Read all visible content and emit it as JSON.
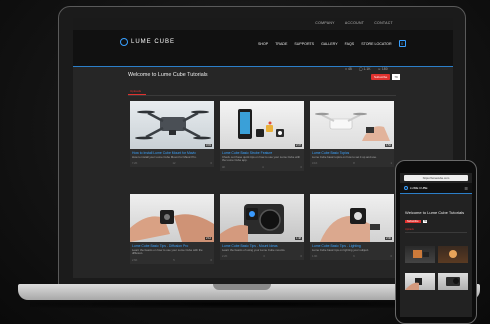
{
  "window": {
    "address": "https://lumecube.com/tutorials"
  },
  "top_links": [
    "COMPANY",
    "ACCOUNT",
    "CONTACT"
  ],
  "brand": {
    "logo_text": "LUME CUBE",
    "accent": "#39a0ff"
  },
  "nav": {
    "items": [
      "SHOP",
      "TRADE",
      "SUPPORTS",
      "GALLERY",
      "FAQS",
      "STORE LOCATOR"
    ],
    "cart_count": "0"
  },
  "page": {
    "title": "Welcome to Lume Cube Tutorials",
    "stats": [
      "45",
      "1.1K",
      "180"
    ],
    "subscribe_label": "Subscribe",
    "subscribe_count": "79",
    "tab_label": "Uploads",
    "accent_red": "#e0322f"
  },
  "cards": [
    {
      "title": "How to Install Lume Cube Mount for Mavic",
      "desc": "How to install your Lume Cube Mount for Mavic Pro.",
      "duration": "3:03",
      "views": "7.2K",
      "likes": "12",
      "comments": "0"
    },
    {
      "title": "Lume Cube Basic Strobe Feature",
      "desc": "Check out these quick tips on how to use your Lume Cube with the Lume Cube app.",
      "duration": "2:47",
      "views": "4K",
      "likes": "4",
      "comments": "0"
    },
    {
      "title": "Lume Cube Basic Topics",
      "desc": "Lume Cube basic topics on how to set it up and use.",
      "duration": "1:52",
      "views": "3.1K",
      "likes": "8",
      "comments": "1"
    },
    {
      "title": "Lume Cube Basic Tips - Diffusion Pro",
      "desc": "Learn the basics on how to use your Lume Cube with the diffusion.",
      "duration": "2:12",
      "views": "2.6K",
      "likes": "5",
      "comments": "0"
    },
    {
      "title": "Lume Cube Basic Tips - Mount Ideas",
      "desc": "Learn the basics of using your Lume Cube mounts.",
      "duration": "1:48",
      "views": "2.2K",
      "likes": "3",
      "comments": "0"
    },
    {
      "title": "Lume Cube Basic Tips - Lighting",
      "desc": "Lume Cube basic tips on lighting your subject.",
      "duration": "2:30",
      "views": "1.9K",
      "likes": "6",
      "comments": "0"
    }
  ],
  "phone": {
    "address": "https://lumecube.com",
    "logo_text": "LUME CUBE",
    "menu_icon": "hamburger-icon",
    "title": "Welcome to Lume Cube Tutorials",
    "subscribe_label": "Subscribe",
    "subscribe_count": "79",
    "tab_label": "Uploads"
  }
}
